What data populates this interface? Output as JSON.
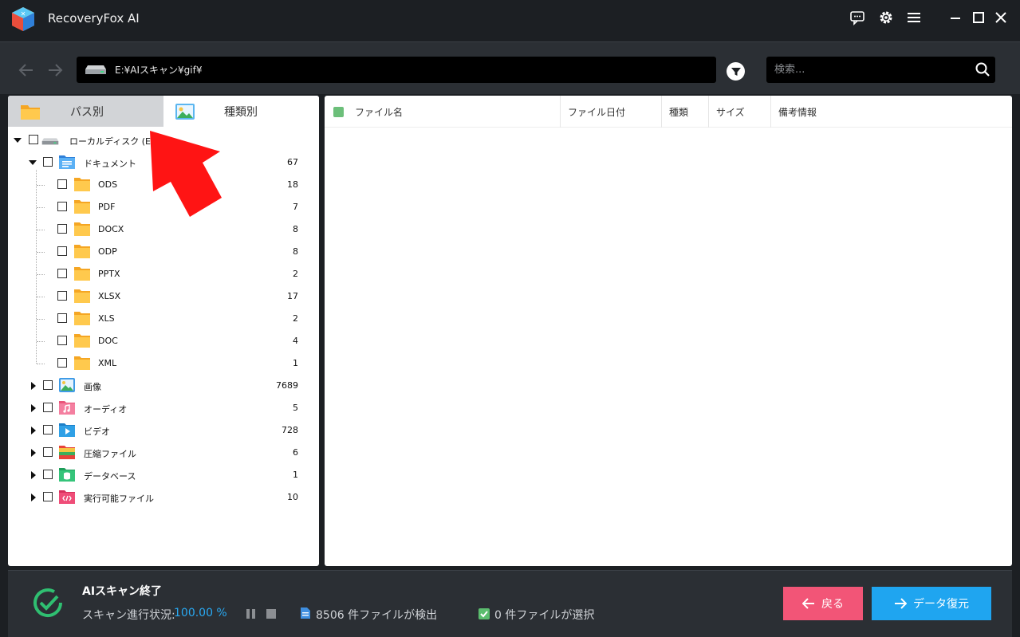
{
  "app": {
    "title": "RecoveryFox AI"
  },
  "toolbar": {
    "path": "E:¥AIスキャン¥gif¥",
    "search_placeholder": "検索..."
  },
  "tabs": [
    {
      "label": "パス別"
    },
    {
      "label": "種類別"
    }
  ],
  "tree": {
    "root": {
      "label": "ローカルディスク (E:)"
    },
    "document": {
      "label": "ドキュメント",
      "count": "67"
    },
    "doc_children": [
      {
        "label": "ODS",
        "count": "18"
      },
      {
        "label": "PDF",
        "count": "7"
      },
      {
        "label": "DOCX",
        "count": "8"
      },
      {
        "label": "ODP",
        "count": "8"
      },
      {
        "label": "PPTX",
        "count": "2"
      },
      {
        "label": "XLSX",
        "count": "17"
      },
      {
        "label": "XLS",
        "count": "2"
      },
      {
        "label": "DOC",
        "count": "4"
      },
      {
        "label": "XML",
        "count": "1"
      }
    ],
    "categories": [
      {
        "label": "画像",
        "count": "7689",
        "icon": "image-folder-icon"
      },
      {
        "label": "オーディオ",
        "count": "5",
        "icon": "audio-folder-icon"
      },
      {
        "label": "ビデオ",
        "count": "728",
        "icon": "video-folder-icon"
      },
      {
        "label": "圧縮ファイル",
        "count": "6",
        "icon": "archive-folder-icon"
      },
      {
        "label": "データベース",
        "count": "1",
        "icon": "database-folder-icon"
      },
      {
        "label": "実行可能ファイル",
        "count": "10",
        "icon": "executable-folder-icon"
      }
    ]
  },
  "columns": [
    {
      "label": "ファイル名"
    },
    {
      "label": "ファイル日付"
    },
    {
      "label": "種類"
    },
    {
      "label": "サイズ"
    },
    {
      "label": "備考情報"
    }
  ],
  "status": {
    "title": "AIスキャン終了",
    "progress_label": "スキャン進行状況:",
    "progress_value": "100.00 %",
    "progress_fraction": 1.0,
    "found": "8506 件ファイルが検出",
    "selected": "0 件ファイルが選択"
  },
  "buttons": {
    "back": "戻る",
    "recover": "データ復元"
  },
  "colors": {
    "accent_blue": "#1fa5f0",
    "back_pink": "#f25577",
    "success_green": "#2fbf71"
  }
}
